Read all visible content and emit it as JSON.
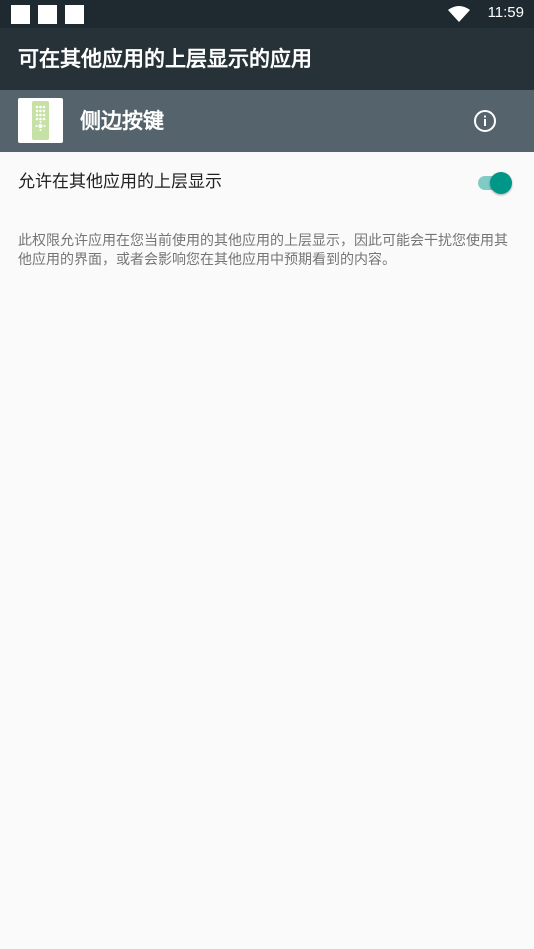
{
  "status_bar": {
    "time": "11:59",
    "icons": [
      "notification-square-icon",
      "notification-square-icon",
      "notification-square-icon",
      "wifi-icon",
      "battery-icon"
    ]
  },
  "toolbar": {
    "title": "可在其他应用的上层显示的应用"
  },
  "app": {
    "name": "侧边按键",
    "icon": "remote-control-app-icon",
    "info_icon": "info-icon"
  },
  "setting": {
    "label": "允许在其他应用的上层显示",
    "enabled": true,
    "accent_color": "#009688"
  },
  "description": "此权限允许应用在您当前使用的其他应用的上层显示，因此可能会干扰您使用其他应用的界面，或者会影响您在其他应用中预期看到的内容。",
  "colors": {
    "status_bar": "#1f2a30",
    "toolbar": "#263238",
    "app_header": "#55646c",
    "background": "#fafafa"
  }
}
